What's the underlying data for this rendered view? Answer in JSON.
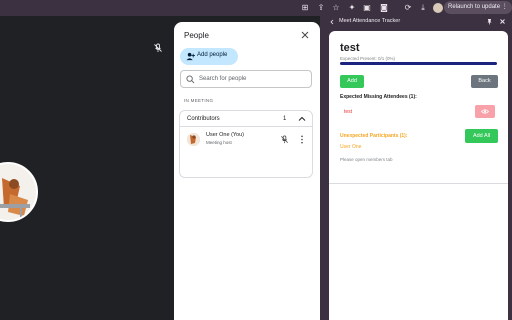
{
  "browser": {
    "relaunch_label": "Relaunch to update",
    "toolbar_icons": [
      "translate-icon",
      "share-icon",
      "star-icon",
      "extensions-icon",
      "side-panel-icon",
      "camera-icon",
      "sync-icon",
      "download-icon",
      "profile-icon"
    ]
  },
  "people_panel": {
    "title": "People",
    "add_people_label": "Add people",
    "search_placeholder": "Search for people",
    "section_label": "IN MEETING",
    "contributors": {
      "label": "Contributors",
      "count": "1",
      "members": [
        {
          "name": "User One (You)",
          "role": "Meeting host"
        }
      ]
    }
  },
  "tracker": {
    "window_title": "Meet Attendance Tracker",
    "title": "test",
    "expected_present": "Expected Present: 0/1 (0%)",
    "progress_fraction": 0,
    "add_label": "Add",
    "back_label": "Back",
    "missing_heading": "Expected Missing Attendees (1):",
    "missing": [
      "test"
    ],
    "unexpected_heading": "Unexpected Participants (1):",
    "unexpected": [
      "User One"
    ],
    "add_all_label": "Add All",
    "footer_note": "Please open members tab"
  },
  "colors": {
    "chrome": "#3c3140",
    "add_people_bg": "#c2e7ff",
    "success": "#34c759",
    "secondary": "#6c757d",
    "danger_text": "#e53935",
    "warning_text": "#f5a623",
    "eye_button": "#f8a1a8",
    "progress_track": "#1a237e"
  }
}
